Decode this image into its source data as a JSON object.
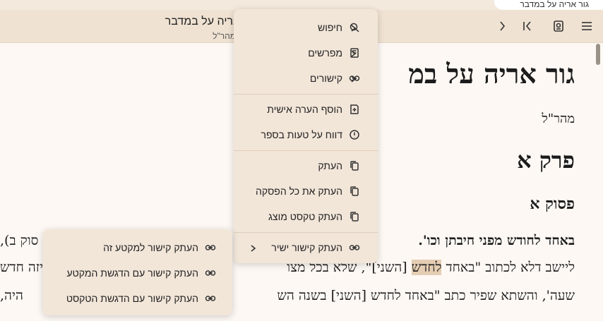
{
  "tab": {
    "title": "גור אריה על במדבר"
  },
  "header": {
    "book_title": "גור אריה על במדבר",
    "book_author": "מהר\"ל"
  },
  "icons": {
    "menu": "hamburger-menu-icon",
    "toc": "book-toc-icon",
    "last_page": "skip-to-end-icon",
    "next": "chevron-right-icon"
  },
  "colors": {
    "toolbar": "#efe2d2",
    "menu_bg": "#f2e6d9",
    "highlight": "#e4cdb2",
    "page_bg": "#fdf8f4"
  },
  "content": {
    "h1": "גור אריה על במ",
    "author": "מהר\"ל",
    "h2": "פרק א",
    "h3": "פסוק א",
    "line1": "באחד לחודש מפני חיבתן וכו'.",
    "line1_left": "סוק ב),",
    "line2_pre": "ליישב דלא לכתוב \"באחד ",
    "line2_hl": "לחדש",
    "line2_post": " [השני]\", שלא בכל מצו",
    "line2_left": "ויזה חדש",
    "line3": "שעה', והשתא שפיר כתב \"באחד לחדש [השני] בשנה הש",
    "line3_left": "היה,"
  },
  "context_menu": {
    "items": [
      {
        "label": "חיפוש",
        "icon": "search-icon",
        "submenu": true
      },
      {
        "label": "מפרשים",
        "icon": "book-icon",
        "submenu": true
      },
      {
        "label": "קישורים",
        "icon": "link-icon",
        "submenu": true
      },
      {
        "label": "הוסף הערה אישית",
        "icon": "add-note-icon",
        "submenu": false
      },
      {
        "label": "דווח על טעות בספר",
        "icon": "alert-circle-icon",
        "submenu": false
      },
      {
        "label": "העתק",
        "icon": "copy-icon",
        "submenu": false
      },
      {
        "label": "העתק את כל הפסקה",
        "icon": "copy-paragraph-icon",
        "submenu": false
      },
      {
        "label": "העתק טקסט מוצג",
        "icon": "copy-text-icon",
        "submenu": false
      },
      {
        "label": "העתק קישור ישיר",
        "icon": "link-icon",
        "submenu": true
      }
    ]
  },
  "submenu": {
    "items": [
      {
        "label": "העתק קישור למקטע זה",
        "icon": "link-icon"
      },
      {
        "label": "העתק קישור עם הדגשת המקטע",
        "icon": "link-icon"
      },
      {
        "label": "העתק קישור עם הדגשת הטקסט",
        "icon": "link-icon"
      }
    ]
  }
}
